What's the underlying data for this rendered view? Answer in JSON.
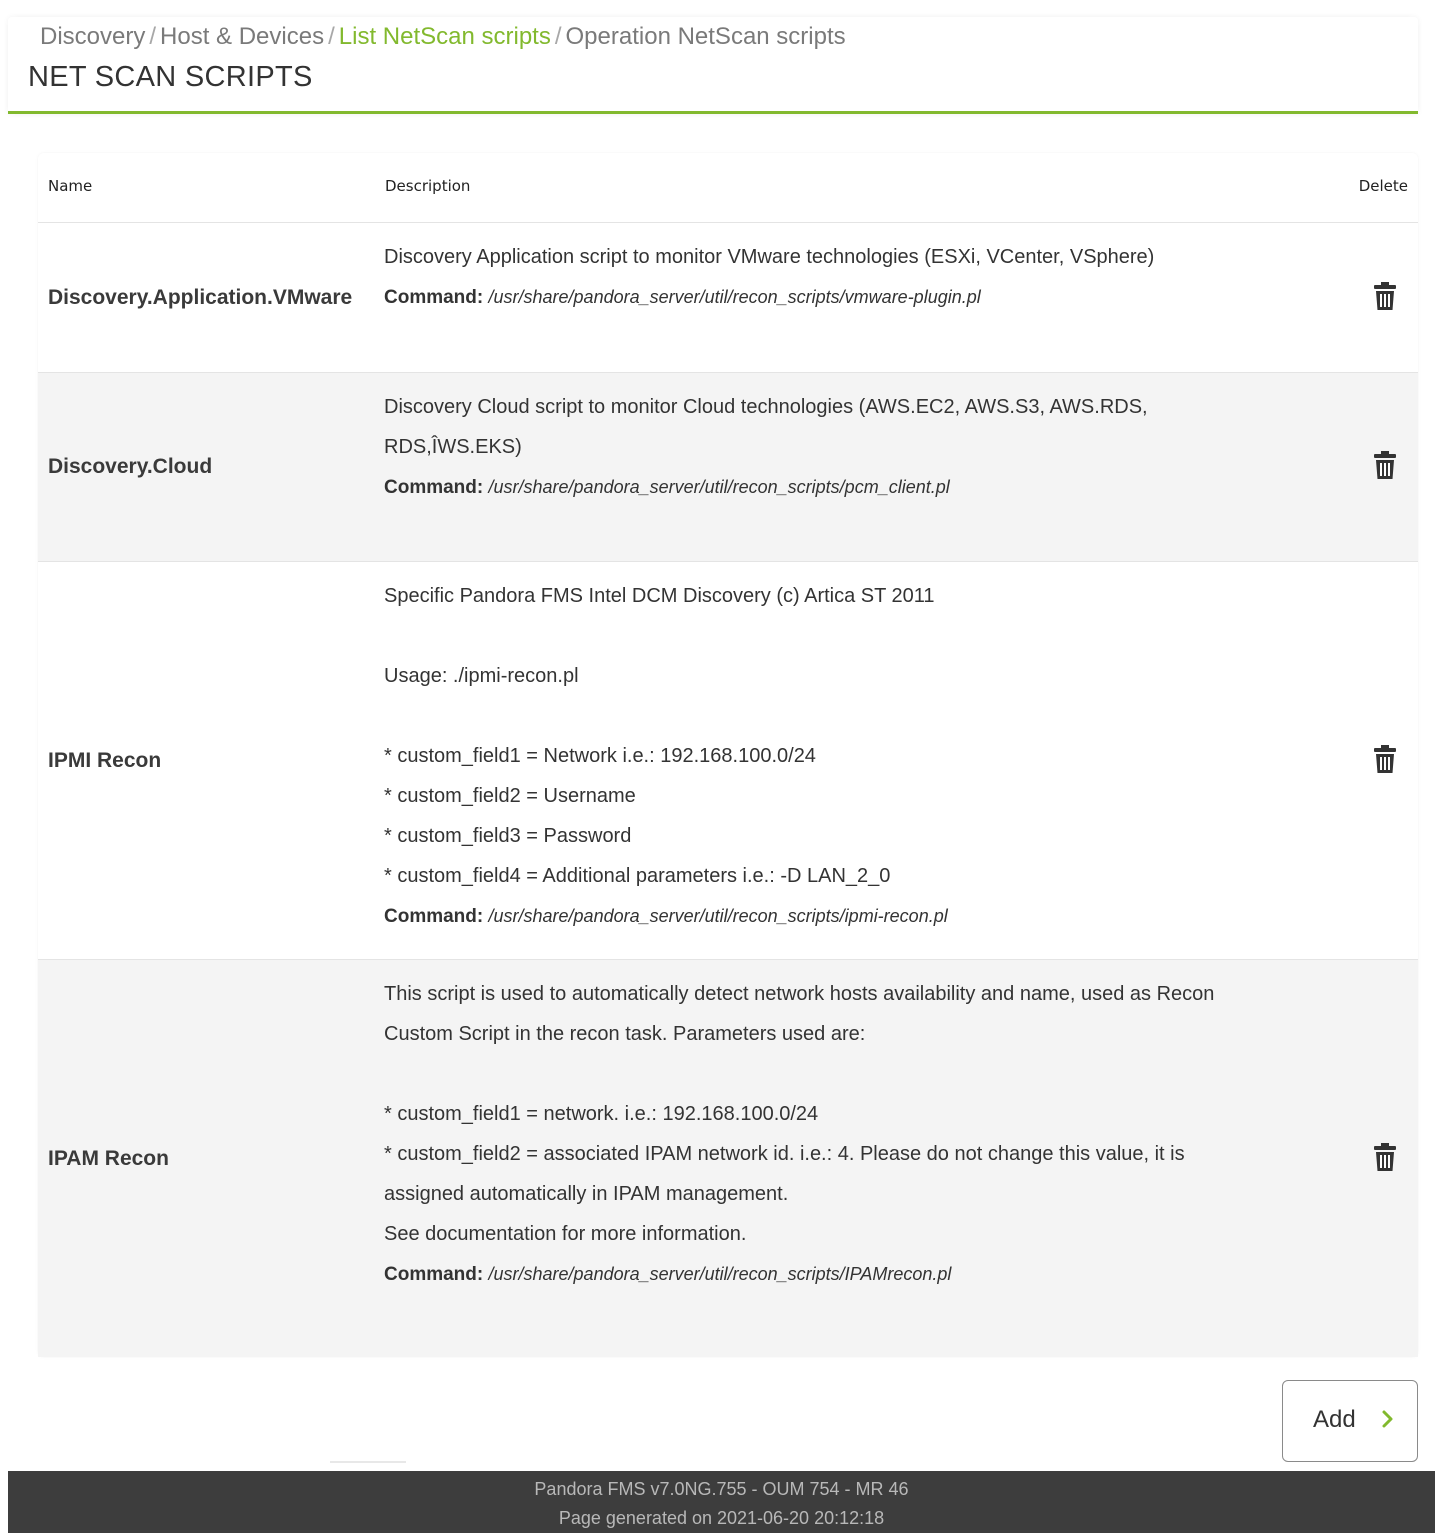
{
  "breadcrumb": {
    "items": [
      "Discovery",
      "Host & Devices",
      "List NetScan scripts",
      "Operation NetScan scripts"
    ],
    "separator": "/"
  },
  "page": {
    "title": "NET SCAN SCRIPTS"
  },
  "table": {
    "headers": {
      "name": "Name",
      "description": "Description",
      "delete": "Delete"
    },
    "command_label": "Command:",
    "rows": [
      {
        "name": "Discovery.Application.VMware",
        "description": "Discovery Application script to monitor VMware technologies (ESXi, VCenter, VSphere)\n ",
        "command": "/usr/share/pandora_server/util/recon_scripts/vmware-plugin.pl"
      },
      {
        "name": "Discovery.Cloud",
        "description": "Discovery Cloud script to monitor Cloud technologies (AWS.EC2, AWS.S3, AWS.RDS,\nRDS,ÎWS.EKS)\n ",
        "command": "/usr/share/pandora_server/util/recon_scripts/pcm_client.pl"
      },
      {
        "name": "IPMI Recon",
        "description": "Specific Pandora FMS Intel DCM Discovery (c) Artica ST 2011\n \nUsage: ./ipmi-recon.pl\n \n* custom_field1 = Network i.e.: 192.168.100.0/24\n* custom_field2 = Username\n* custom_field3 = Password\n* custom_field4 = Additional parameters i.e.: -D LAN_2_0",
        "command": "/usr/share/pandora_server/util/recon_scripts/ipmi-recon.pl"
      },
      {
        "name": "IPAM Recon",
        "description": "This script is used to automatically detect network hosts availability and name, used as Recon\nCustom Script in the recon task. Parameters used are:\n \n* custom_field1 = network. i.e.: 192.168.100.0/24\n* custom_field2 = associated IPAM network id. i.e.: 4. Please do not change this value, it is\nassigned automatically in IPAM management.\nSee documentation for more information.\n ",
        "command": "/usr/share/pandora_server/util/recon_scripts/IPAMrecon.pl"
      }
    ]
  },
  "add_button": {
    "label": "Add"
  },
  "footer": {
    "version": "Pandora FMS v7.0NG.755 - OUM 754 - MR 46",
    "generated": "Page generated on 2021-06-20 20:12:18"
  },
  "colors": {
    "accent": "#82b92e",
    "footer_bg": "#3d3d3d",
    "row_alt": "#f4f4f4"
  },
  "icons": {
    "delete": "trash-icon",
    "add_arrow": "chevron-right-icon"
  }
}
